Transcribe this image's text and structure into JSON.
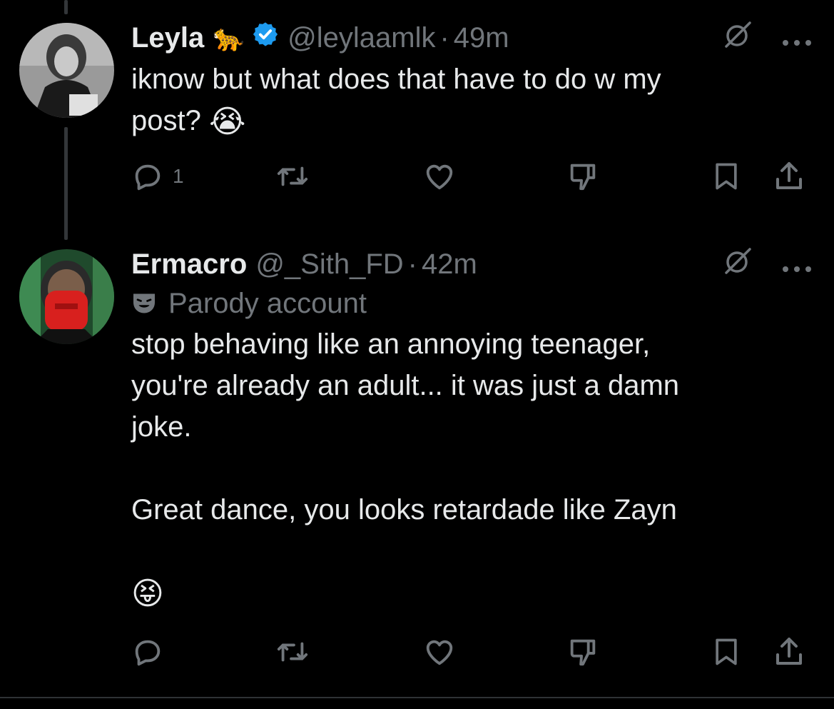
{
  "tweets": [
    {
      "name": "Leyla",
      "handle": "@leylaamlk",
      "separator": "·",
      "time": "49m",
      "name_emoji": "🐆",
      "verified": true,
      "text": "iknow but what does that have to do w my\npost?",
      "text_emoji": "😭",
      "reply_count": "1"
    },
    {
      "name": "Ermacro",
      "handle": "@_Sith_FD",
      "separator": "·",
      "time": "42m",
      "parody_label": "Parody account",
      "text": "stop behaving like an annoying teenager,\nyou're already an adult... it was just a damn\njoke.\n\nGreat dance, you looks retardade like Zayn\n\n",
      "text_emoji": "😝",
      "reply_count": ""
    }
  ],
  "icons": {
    "verified": "verified-badge-icon",
    "grok": "grok-icon",
    "more": "more-icon",
    "reply": "reply-icon",
    "retweet": "retweet-icon",
    "like": "like-icon",
    "dislike": "dislike-icon",
    "bookmark": "bookmark-icon",
    "share": "share-icon",
    "parody": "parody-mask-icon"
  },
  "colors": {
    "background": "#000000",
    "text": "#e7e9ea",
    "muted": "#71767b",
    "verified": "#1d9bf0",
    "divider": "#2f3336"
  }
}
